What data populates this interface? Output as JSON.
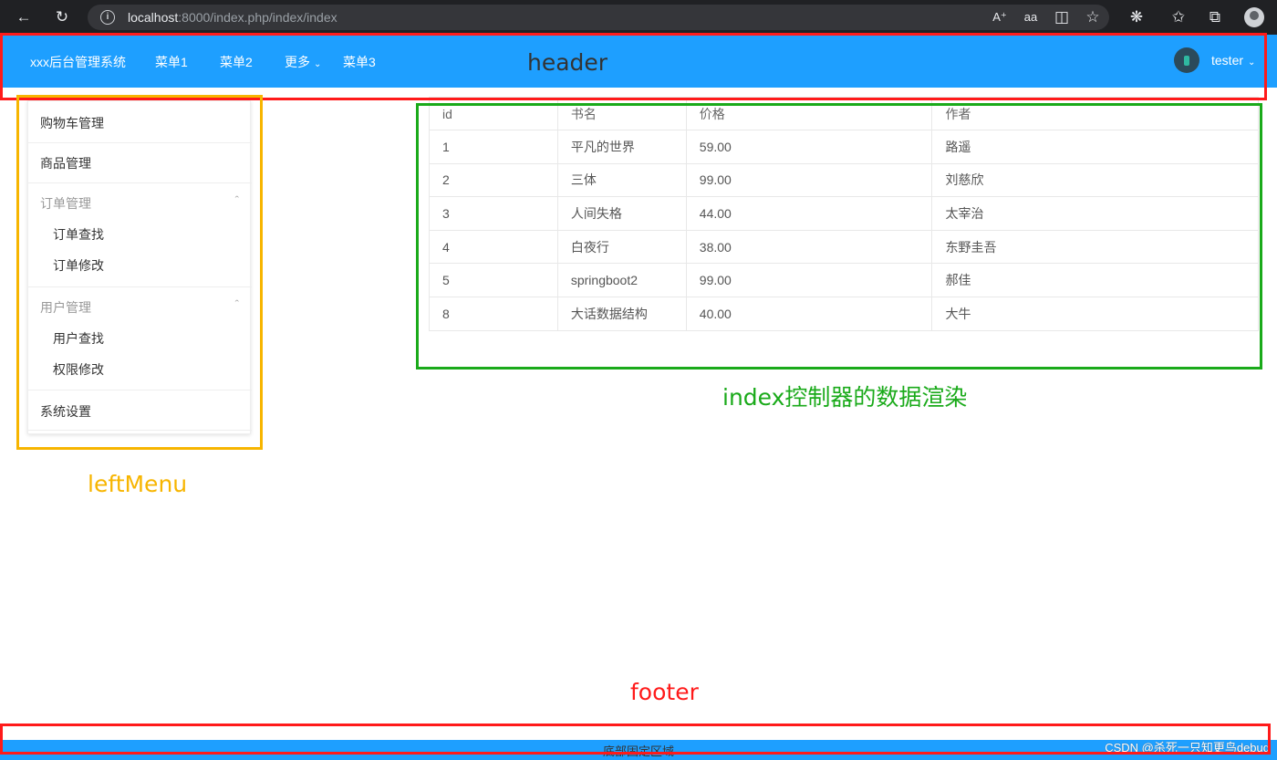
{
  "browser": {
    "url_host": "localhost",
    "url_path": ":8000/index.php/index/index"
  },
  "header": {
    "brand": "xxx后台管理系统",
    "menus": [
      "菜单1",
      "菜单2",
      "更多",
      "菜单3"
    ],
    "user": "tester"
  },
  "left_menu": {
    "items": [
      {
        "label": "购物车管理"
      },
      {
        "label": "商品管理"
      },
      {
        "label": "订单管理",
        "children": [
          "订单查找",
          "订单修改"
        ]
      },
      {
        "label": "用户管理",
        "children": [
          "用户查找",
          "权限修改"
        ]
      },
      {
        "label": "系统设置"
      }
    ]
  },
  "table": {
    "headers": [
      "id",
      "书名",
      "价格",
      "作者"
    ],
    "rows": [
      [
        "1",
        "平凡的世界",
        "59.00",
        "路遥"
      ],
      [
        "2",
        "三体",
        "99.00",
        "刘慈欣"
      ],
      [
        "3",
        "人间失格",
        "44.00",
        "太宰治"
      ],
      [
        "4",
        "白夜行",
        "38.00",
        "东野圭吾"
      ],
      [
        "5",
        "springboot2",
        "99.00",
        "郝佳"
      ],
      [
        "8",
        "大话数据结构",
        "40.00",
        "大牛"
      ]
    ]
  },
  "annotations": {
    "header": "header",
    "left_menu": "leftMenu",
    "content": "index控制器的数据渲染",
    "footer": "footer"
  },
  "footer": {
    "text": "底部固定区域",
    "watermark": "CSDN @杀死一只知更鸟debug"
  },
  "colors": {
    "header_bg": "#1e9fff",
    "annotation_red": "#ff1a1a",
    "annotation_yellow": "#f7b500",
    "annotation_green": "#1aaa1a"
  }
}
